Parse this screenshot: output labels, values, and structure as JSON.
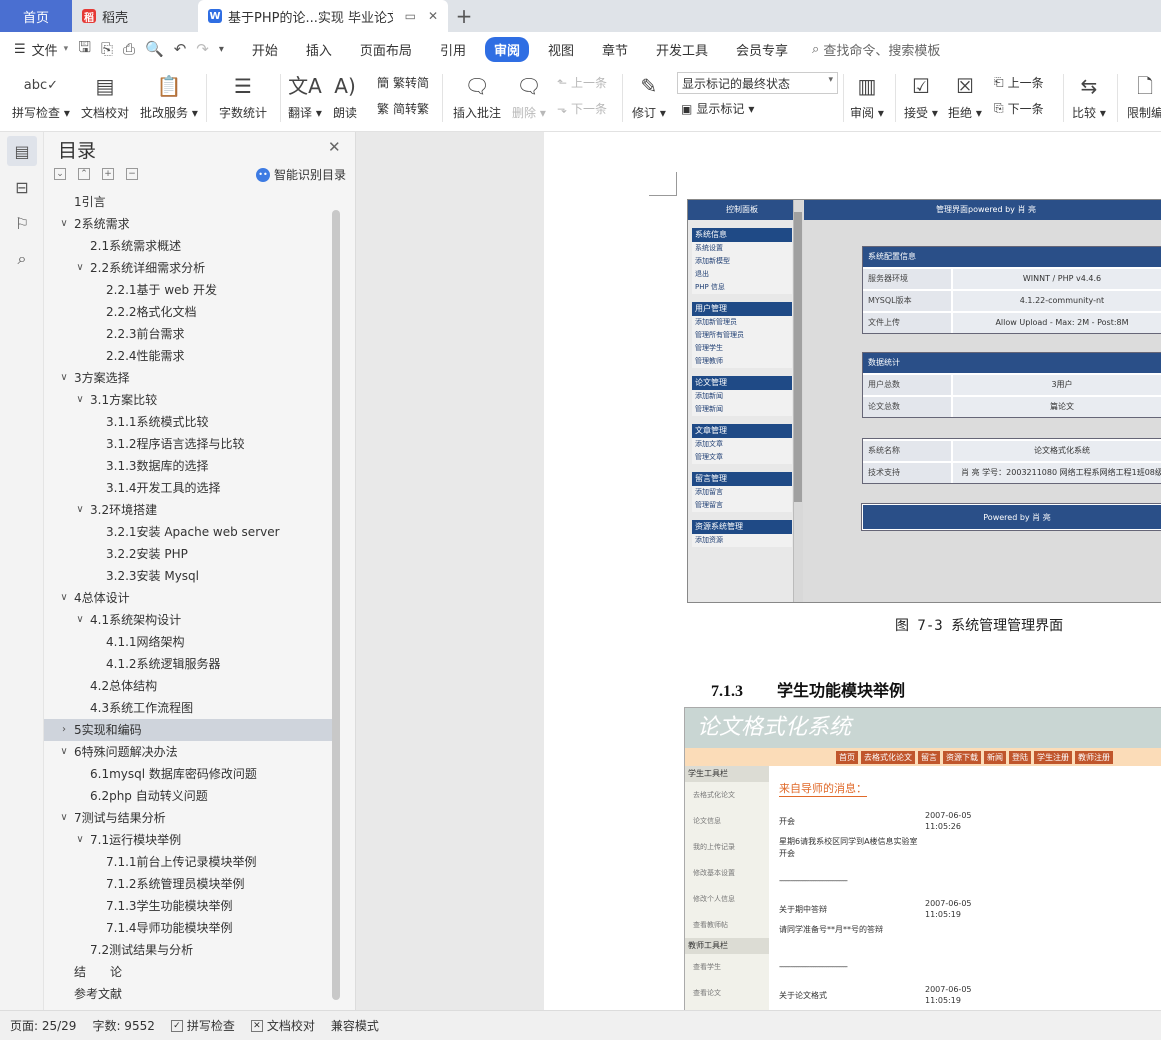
{
  "tabs": {
    "home": "首页",
    "docer": "稻壳",
    "doc": "基于PHP的论...实现 毕业论文",
    "add": "+"
  },
  "menu": {
    "file": "文件",
    "items": [
      "开始",
      "插入",
      "页面布局",
      "引用",
      "审阅",
      "视图",
      "章节",
      "开发工具",
      "会员专享"
    ],
    "active": "审阅",
    "search": "查找命令、搜索模板"
  },
  "ribbon": {
    "spell": "拼写检查",
    "proof": "文档校对",
    "review_service": "批改服务",
    "wordcount": "字数统计",
    "translate": "翻译",
    "read": "朗读",
    "trad": "繁转简",
    "simp": "简转繁",
    "insert_comment": "插入批注",
    "delete": "删除",
    "prev": "上一条",
    "next": "下一条",
    "track": "修订",
    "markup_select": "显示标记的最终状态",
    "show_markup": "显示标记",
    "review": "审阅",
    "accept": "接受",
    "reject": "拒绝",
    "prev2": "上一条",
    "next2": "下一条",
    "compare": "比较",
    "restrict": "限制编"
  },
  "toc": {
    "title": "目录",
    "smart": "智能识别目录",
    "items": [
      {
        "text": "1引言",
        "level": 1,
        "arrow": ""
      },
      {
        "text": "2系统需求",
        "level": 1,
        "arrow": "v"
      },
      {
        "text": "2.1系统需求概述",
        "level": 2,
        "arrow": ""
      },
      {
        "text": "2.2系统详细需求分析",
        "level": 2,
        "arrow": "v"
      },
      {
        "text": "2.2.1基于 web 开发",
        "level": 3,
        "arrow": ""
      },
      {
        "text": "2.2.2格式化文档",
        "level": 3,
        "arrow": ""
      },
      {
        "text": "2.2.3前台需求",
        "level": 3,
        "arrow": ""
      },
      {
        "text": "2.2.4性能需求",
        "level": 3,
        "arrow": ""
      },
      {
        "text": "3方案选择",
        "level": 1,
        "arrow": "v"
      },
      {
        "text": "3.1方案比较",
        "level": 2,
        "arrow": "v"
      },
      {
        "text": "3.1.1系统模式比较",
        "level": 3,
        "arrow": ""
      },
      {
        "text": "3.1.2程序语言选择与比较",
        "level": 3,
        "arrow": ""
      },
      {
        "text": "3.1.3数据库的选择",
        "level": 3,
        "arrow": ""
      },
      {
        "text": "3.1.4开发工具的选择",
        "level": 3,
        "arrow": ""
      },
      {
        "text": "3.2环境搭建",
        "level": 2,
        "arrow": "v"
      },
      {
        "text": "3.2.1安装 Apache web server",
        "level": 3,
        "arrow": ""
      },
      {
        "text": "3.2.2安装 PHP",
        "level": 3,
        "arrow": ""
      },
      {
        "text": "3.2.3安装 Mysql",
        "level": 3,
        "arrow": ""
      },
      {
        "text": "4总体设计",
        "level": 1,
        "arrow": "v"
      },
      {
        "text": "4.1系统架构设计",
        "level": 2,
        "arrow": "v"
      },
      {
        "text": "4.1.1网络架构",
        "level": 3,
        "arrow": ""
      },
      {
        "text": "4.1.2系统逻辑服务器",
        "level": 3,
        "arrow": ""
      },
      {
        "text": "4.2总体结构",
        "level": 2,
        "arrow": ""
      },
      {
        "text": "4.3系统工作流程图",
        "level": 2,
        "arrow": ""
      },
      {
        "text": "5实现和编码",
        "level": 1,
        "arrow": ">",
        "selected": true
      },
      {
        "text": "6特殊问题解决办法",
        "level": 1,
        "arrow": "v"
      },
      {
        "text": "6.1mysql 数据库密码修改问题",
        "level": 2,
        "arrow": ""
      },
      {
        "text": "6.2php 自动转义问题",
        "level": 2,
        "arrow": ""
      },
      {
        "text": "7测试与结果分析",
        "level": 1,
        "arrow": "v"
      },
      {
        "text": "7.1运行模块举例",
        "level": 2,
        "arrow": "v"
      },
      {
        "text": "7.1.1前台上传记录模块举例",
        "level": 3,
        "arrow": ""
      },
      {
        "text": "7.1.2系统管理员模块举例",
        "level": 3,
        "arrow": ""
      },
      {
        "text": "7.1.3学生功能模块举例",
        "level": 3,
        "arrow": ""
      },
      {
        "text": "7.1.4导师功能模块举例",
        "level": 3,
        "arrow": ""
      },
      {
        "text": "7.2测试结果与分析",
        "level": 2,
        "arrow": ""
      },
      {
        "text": "结　　论",
        "level": 1,
        "arrow": ""
      },
      {
        "text": "参考文献",
        "level": 1,
        "arrow": ""
      }
    ]
  },
  "figure1": {
    "side_header": "控制面板",
    "top_header": "管理界面powered by 肖 亮",
    "groups": [
      {
        "title": "系统信息",
        "links": [
          "系统设置",
          "添加新模型",
          "退出",
          "PHP 信息"
        ]
      },
      {
        "title": "用户管理",
        "links": [
          "添加新管理员",
          "管理所有管理员",
          "管理学生",
          "管理教师"
        ]
      },
      {
        "title": "论文管理",
        "links": [
          "添加新闻",
          "管理新闻"
        ]
      },
      {
        "title": "文章管理",
        "links": [
          "添加文章",
          "管理文章"
        ]
      },
      {
        "title": "留言管理",
        "links": [
          "添加留言",
          "管理留言"
        ]
      },
      {
        "title": "资源系统管理",
        "links": [
          "添加资源"
        ]
      }
    ],
    "boxes": [
      {
        "title": "系统配置信息",
        "rows": [
          [
            "服务器环境",
            "WINNT / PHP v4.4.6"
          ],
          [
            "MYSQL版本",
            "4.1.22-community-nt"
          ],
          [
            "文件上传",
            "Allow Upload - Max: 2M - Post:8M"
          ]
        ]
      },
      {
        "title": "数据统计",
        "rows": [
          [
            "用户总数",
            "3用户"
          ],
          [
            "论文总数",
            "篇论文"
          ]
        ]
      },
      {
        "title": "",
        "rows": [
          [
            "系统名称",
            "论文格式化系统"
          ],
          [
            "技术支持",
            "肖 亮 学号：2003211080 网络工程系网络工程1班08级"
          ]
        ]
      }
    ],
    "powered": "Powered by 肖 亮"
  },
  "caption1": "图 7-3 系统管理管理界面",
  "heading": {
    "num": "7.1.3",
    "text": "学生功能模块举例"
  },
  "figure2": {
    "banner": "论文格式化系统",
    "nav": [
      "首页",
      "去格式化论文",
      "留言",
      "资源下载",
      "新闻",
      "登陆",
      "学生注册",
      "教师注册"
    ],
    "student_head": "学生工具栏",
    "student_links": [
      "去格式化论文",
      "论文信息",
      "我的上传记录",
      "修改基本设置",
      "修改个人信息",
      "查看教师帖"
    ],
    "teacher_head": "教师工具栏",
    "teacher_links": [
      "查看学生",
      "查看论文"
    ],
    "msg_head": "来自导师的消息：",
    "messages": [
      {
        "title": "开会",
        "date": "2007-06-05",
        "time": "11:05:26"
      },
      {
        "title": "星期6请我系校区同学到A楼信息实验室开会",
        "date": "",
        "time": ""
      },
      {
        "title": "关于期中答辩",
        "date": "2007-06-05",
        "time": "11:05:19"
      },
      {
        "title": "请同学准备号**月**号的答辩",
        "date": "",
        "time": ""
      },
      {
        "title": "关于论文格式",
        "date": "2007-06-05",
        "time": "11:05:19"
      }
    ],
    "divider": "------------------------------------"
  },
  "status": {
    "page": "页面: 25/29",
    "words": "字数: 9552",
    "spell": "拼写检查",
    "proof": "文档校对",
    "compat": "兼容模式"
  }
}
